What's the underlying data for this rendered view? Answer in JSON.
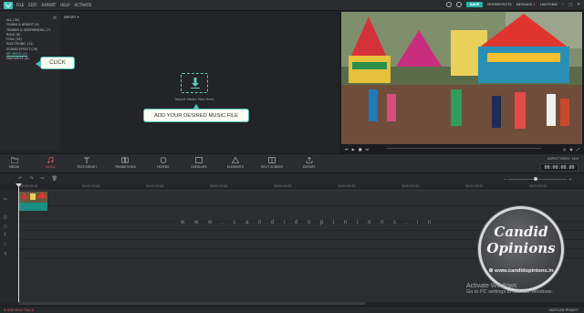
{
  "menubar": {
    "items": [
      "FILE",
      "EDIT",
      "EXPORT",
      "HELP",
      "ACTIVATE"
    ],
    "save": "SAVE",
    "more_effects": "MOREEFFECTS",
    "message": "MESSAGE",
    "message_count": "8",
    "skin": "LIGHTSKIN",
    "window_buttons": [
      "–",
      "□",
      "✕"
    ]
  },
  "categories": {
    "items": [
      "ALL (35)",
      "YOUNG & BRIGHT (9)",
      "TENDER & SENTIMENTAL (7)",
      "ROCK (6)",
      "FOLK (10)",
      "ELECTRONIC (11)",
      "SOUND EFFECT (26)",
      "MY MUSIC (0)",
      "FAVOURITE (0)"
    ],
    "selected_index": 7
  },
  "media": {
    "import_label": "IMPORT",
    "import_hint": "Import Media Files Here"
  },
  "annotations": {
    "click": "CLICK",
    "add_music": "ADD YOUR DESIRED MUSIC FILE"
  },
  "toolbar": {
    "tools": [
      {
        "label": "MEDIA",
        "icon": "folder-icon"
      },
      {
        "label": "MUSIC",
        "icon": "music-note-icon"
      },
      {
        "label": "TEXT/CREDIT",
        "icon": "text-icon"
      },
      {
        "label": "TRANSITIONS",
        "icon": "transitions-icon"
      },
      {
        "label": "FILTERS",
        "icon": "filter-icon"
      },
      {
        "label": "OVERLAYS",
        "icon": "overlay-icon"
      },
      {
        "label": "ELEMENTS",
        "icon": "elements-icon"
      },
      {
        "label": "SPLIT SCREEN",
        "icon": "split-screen-icon"
      },
      {
        "label": "EXPORT",
        "icon": "export-icon"
      }
    ],
    "active_tool": "MUSIC",
    "aspect_ratio": "ASPECT RATIO: 16:9",
    "timecode": "00:00:00.00"
  },
  "timeline": {
    "ruler_ticks": [
      "00:00:00:00",
      "00:00:10:00",
      "00:00:20:00",
      "00:00:30:00",
      "00:00:40:00",
      "00:00:50:00",
      "00:01:00:00",
      "00:01:10:00",
      "00:01:20:00"
    ]
  },
  "watermark": {
    "site_spaced": "w w w . c a n d i d o p i n i o n s . i n",
    "badge_line1": "Candid",
    "badge_line2": "Opinions",
    "badge_url": "www.candidopinions.in"
  },
  "windows_notice": {
    "title": "Activate Windows",
    "subtitle": "Go to PC settings to activate Windows."
  },
  "statusbar": {
    "add_track": "ADD NEW TRACK",
    "project": "UNTITLED PROJECT"
  },
  "colors": {
    "accent": "#2ab3a6",
    "active_tool": "#e05a5a",
    "background": "#222427"
  }
}
